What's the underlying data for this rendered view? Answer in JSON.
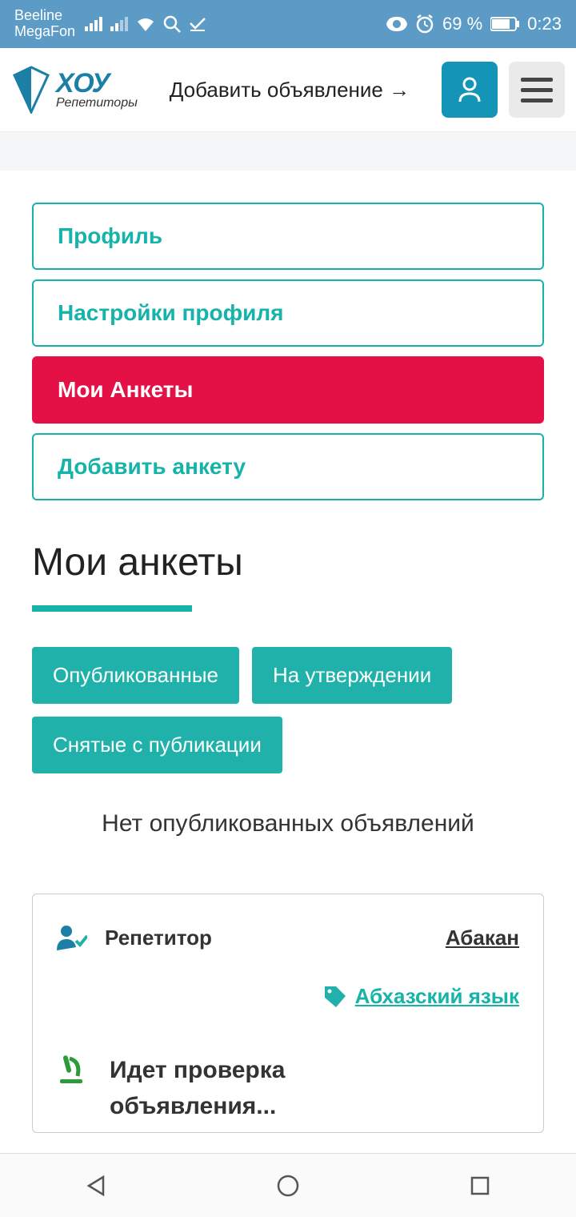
{
  "status": {
    "carrier1": "Beeline",
    "carrier2": "MegaFon",
    "battery": "69 %",
    "time": "0:23"
  },
  "header": {
    "logo_top": "ХОУ",
    "logo_sub": "Репетиторы",
    "add_listing": "Добавить объявление →"
  },
  "nav": {
    "items": [
      {
        "label": "Профиль",
        "active": false
      },
      {
        "label": "Настройки профиля",
        "active": false
      },
      {
        "label": "Мои Анкеты",
        "active": true
      },
      {
        "label": "Добавить анкету",
        "active": false
      }
    ]
  },
  "page": {
    "title": "Мои анкеты",
    "filters": [
      "Опубликованные",
      "На утверждении",
      "Снятые с публикации"
    ],
    "empty": "Нет опубликованных объявлений"
  },
  "card": {
    "role": "Репетитор",
    "city": "Абакан",
    "subject": "Абхазский язык",
    "status": "Идет проверка объявления..."
  }
}
